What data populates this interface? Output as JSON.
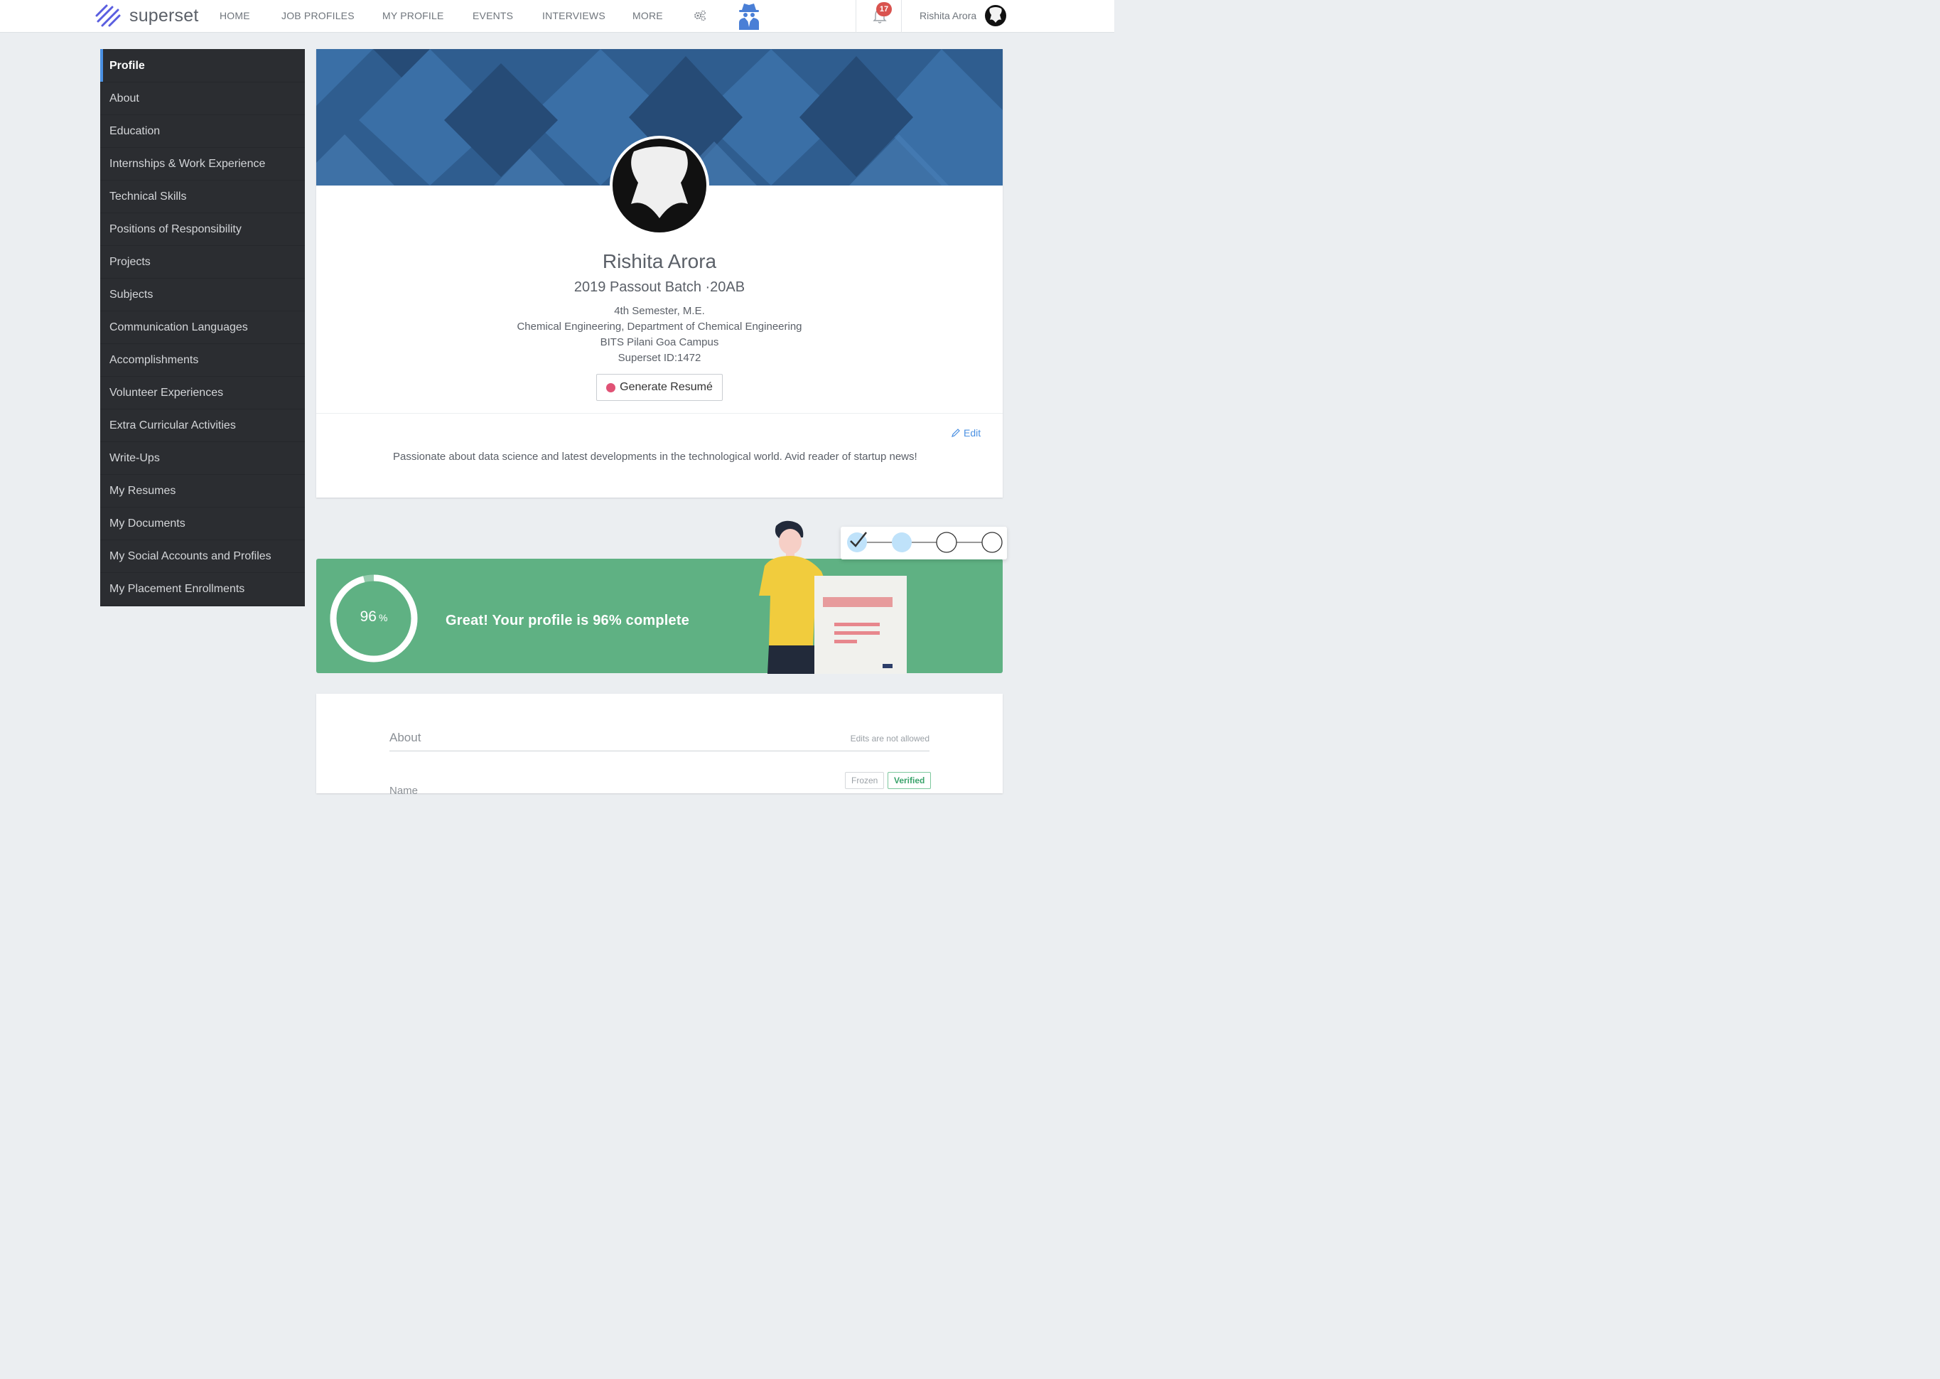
{
  "brand": {
    "name": "superset"
  },
  "nav": {
    "links": [
      "HOME",
      "JOB PROFILES",
      "MY PROFILE",
      "EVENTS",
      "INTERVIEWS",
      "MORE"
    ],
    "notification_count": "17",
    "user_name": "Rishita Arora"
  },
  "sidebar": {
    "items": [
      "Profile",
      "About",
      "Education",
      "Internships & Work Experience",
      "Technical Skills",
      "Positions of Responsibility",
      "Projects",
      "Subjects",
      "Communication Languages",
      "Accomplishments",
      "Volunteer Experiences",
      "Extra Curricular Activities",
      "Write-Ups",
      "My Resumes",
      "My Documents",
      "My Social Accounts and Profiles",
      "My Placement Enrollments"
    ]
  },
  "profile": {
    "name": "Rishita Arora",
    "batch": "2019 Passout Batch ·20AB",
    "semester": "4th Semester, M.E.",
    "department": "Chemical Engineering, Department of Chemical Engineering",
    "campus": "BITS Pilani Goa Campus",
    "superset_id": "Superset ID:1472",
    "generate_button": "Generate Resumé",
    "edit_label": "Edit",
    "bio": "Passionate about data science and latest developments in the technological world. Avid reader of startup news!"
  },
  "completion": {
    "percent": 96,
    "percent_label": "96",
    "percent_sign": "%",
    "message": "Great! Your profile is 96% complete"
  },
  "about": {
    "title": "About",
    "note": "Edits are not allowed",
    "tag_frozen": "Frozen",
    "tag_verified": "Verified",
    "first_field": "Name"
  },
  "colors": {
    "accent": "#4a90e2",
    "sidebar_bg": "#2b2d31",
    "completion_bg": "#5fb183",
    "badge": "#d9534f",
    "record_dot": "#e05275"
  }
}
